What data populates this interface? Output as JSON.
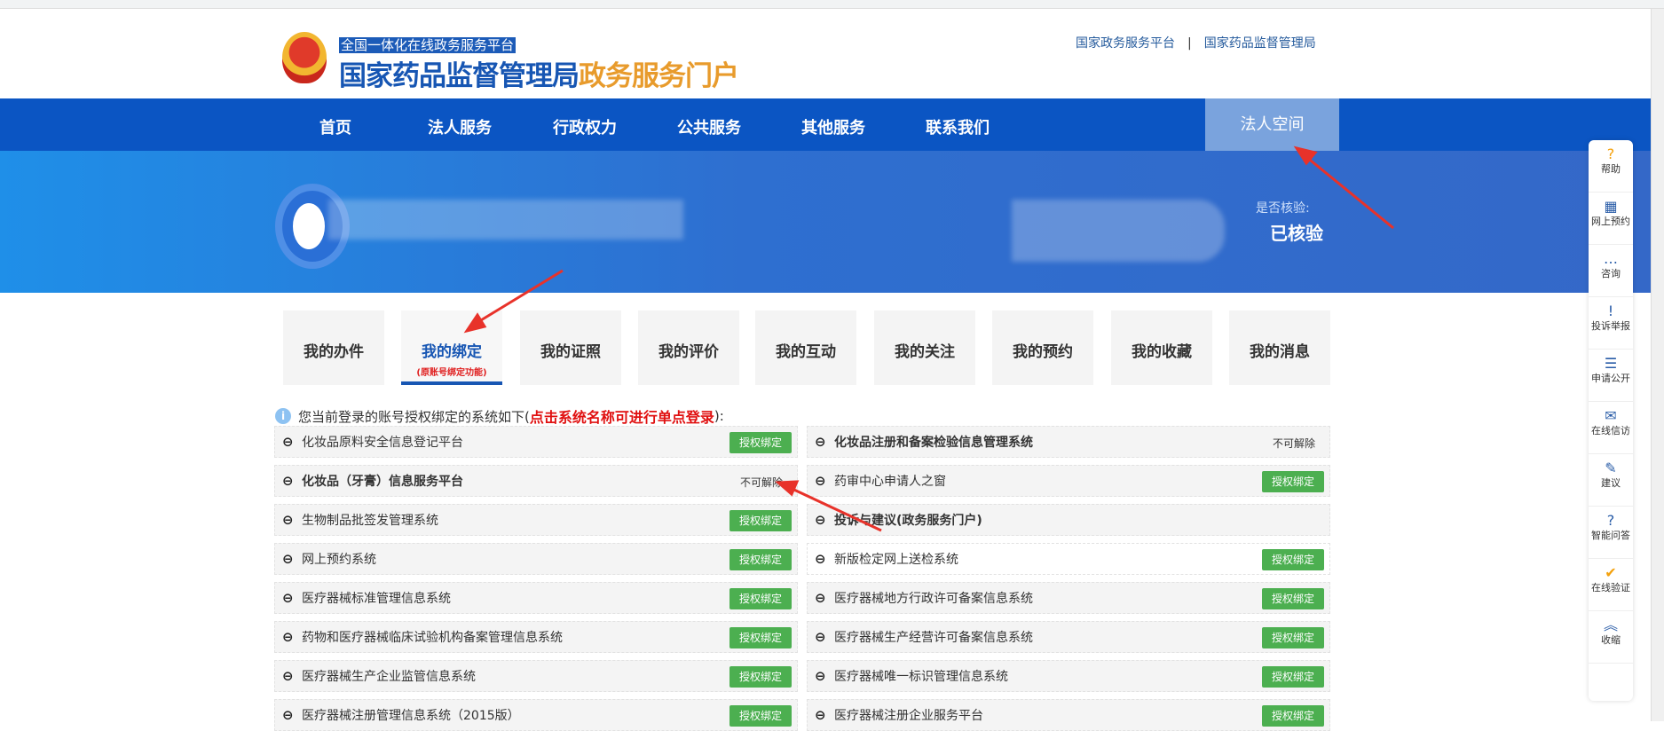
{
  "header": {
    "subtitle": "全国一体化在线政务服务平台",
    "title_blue": "国家药品监督管理局",
    "title_orange": "政务服务门户",
    "links": [
      "国家政务服务平台",
      "国家药品监督管理局"
    ],
    "link_sep": "|"
  },
  "nav": {
    "items": [
      "首页",
      "法人服务",
      "行政权力",
      "公共服务",
      "其他服务",
      "联系我们"
    ],
    "space": "法人空间"
  },
  "banner": {
    "verify_label": "是否核验:",
    "verify_value": "已核验"
  },
  "tabs": [
    {
      "label": "我的办件"
    },
    {
      "label": "我的绑定",
      "note": "(原账号绑定功能)"
    },
    {
      "label": "我的证照"
    },
    {
      "label": "我的评价"
    },
    {
      "label": "我的互动"
    },
    {
      "label": "我的关注"
    },
    {
      "label": "我的预约"
    },
    {
      "label": "我的收藏"
    },
    {
      "label": "我的消息"
    }
  ],
  "info": {
    "text": "您当前登录的账号授权绑定的系统如下(",
    "highlight": "点击系统名称可进行单点登录",
    "tail": "):"
  },
  "systems": [
    {
      "name": "化妆品原料安全信息登记平台",
      "action": "授权绑定"
    },
    {
      "name": "化妆品注册和备案检验信息管理系统",
      "status": "不可解除",
      "bold": true
    },
    {
      "name": "化妆品（牙膏）信息服务平台",
      "status": "不可解除",
      "bold": true
    },
    {
      "name": "药审中心申请人之窗",
      "action": "授权绑定"
    },
    {
      "name": "生物制品批签发管理系统",
      "action": "授权绑定"
    },
    {
      "name": "投诉与建议(政务服务门户)",
      "bold": true
    },
    {
      "name": "网上预约系统",
      "action": "授权绑定"
    },
    {
      "name": "新版检定网上送检系统",
      "action": "授权绑定"
    },
    {
      "name": "医疗器械标准管理信息系统",
      "action": "授权绑定"
    },
    {
      "name": "医疗器械地方行政许可备案信息系统",
      "action": "授权绑定"
    },
    {
      "name": "药物和医疗器械临床试验机构备案管理信息系统",
      "action": "授权绑定"
    },
    {
      "name": "医疗器械生产经营许可备案信息系统",
      "action": "授权绑定"
    },
    {
      "name": "医疗器械生产企业监管信息系统",
      "action": "授权绑定"
    },
    {
      "name": "医疗器械唯一标识管理信息系统",
      "action": "授权绑定"
    },
    {
      "name": "医疗器械注册管理信息系统（2015版）",
      "action": "授权绑定"
    },
    {
      "name": "医疗器械注册企业服务平台",
      "action": "授权绑定"
    }
  ],
  "side": [
    {
      "label": "帮助",
      "icon": "help-icon",
      "glyph": "?",
      "orange": true
    },
    {
      "label": "网上预约",
      "icon": "calendar-icon",
      "glyph": "▦"
    },
    {
      "label": "咨询",
      "icon": "chat-icon",
      "glyph": "…"
    },
    {
      "label": "投诉举报",
      "icon": "shield-alert-icon",
      "glyph": "!"
    },
    {
      "label": "申请公开",
      "icon": "clipboard-icon",
      "glyph": "☰"
    },
    {
      "label": "在线信访",
      "icon": "mail-icon",
      "glyph": "✉"
    },
    {
      "label": "建议",
      "icon": "edit-icon",
      "glyph": "✎"
    },
    {
      "label": "智能问答",
      "icon": "qa-icon",
      "glyph": "?"
    },
    {
      "label": "在线验证",
      "icon": "verify-shield-icon",
      "glyph": "✔",
      "orange": true
    },
    {
      "label": "收缩",
      "icon": "collapse-icon",
      "glyph": "︽"
    }
  ],
  "colors": {
    "nav": "#0b55c3",
    "accent": "#1756b3",
    "green": "#4caf50",
    "orange": "#e89b2c",
    "red": "#e01010"
  }
}
